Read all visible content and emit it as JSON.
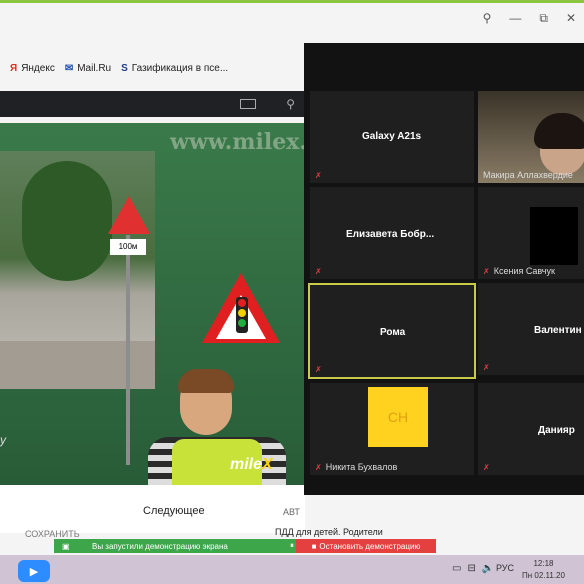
{
  "window_controls": {
    "search": "⚲",
    "minimize": "—",
    "maximize": "⧉",
    "close": "✕"
  },
  "bookmarks": [
    {
      "icon": "Я",
      "label": "Яндекс",
      "color": "#e03020"
    },
    {
      "icon": "✉",
      "label": "Mail.Ru",
      "color": "#1c4db0"
    },
    {
      "icon": "S",
      "label": "Газификация в псе...",
      "color": "#1c3d8c"
    }
  ],
  "video": {
    "watermark": "www.milex.b",
    "sign_plate": "100м",
    "logo_main": "mile",
    "logo_accent": "X",
    "left_fragment": "y"
  },
  "below_video": {
    "next_label": "Следующее",
    "auto_label": "АВТ",
    "related_title": "ПДД для детей. Родители",
    "save_label": "СОХРАНИТЬ"
  },
  "zoom": {
    "tiles": [
      {
        "name": "Galaxy A21s",
        "caption": ""
      },
      {
        "name": "",
        "caption": "Макира Аллахвердие"
      },
      {
        "name": "Елизавета  Бобр...",
        "caption": ""
      },
      {
        "name": "",
        "caption": "Ксения Савчук"
      },
      {
        "name": "Рома",
        "caption": ""
      },
      {
        "name": "Валентин",
        "caption": ""
      },
      {
        "name": "",
        "caption": "Никита Бухвалов",
        "avatar": "CH"
      },
      {
        "name": "Данияр",
        "caption": ""
      }
    ]
  },
  "share": {
    "bar_text": "Вы запустили демонстрацию экрана",
    "stop_label": "Остановить демонстрацию"
  },
  "taskbar": {
    "zoom_icon": "▶",
    "lang": "РУС",
    "time": "12:18",
    "date": "Пн 02.11.20"
  },
  "colors": {
    "accent": "#8cc63f",
    "share_green": "#3da64a",
    "stop_red": "#e54040",
    "zoom_blue": "#2d8cff"
  }
}
